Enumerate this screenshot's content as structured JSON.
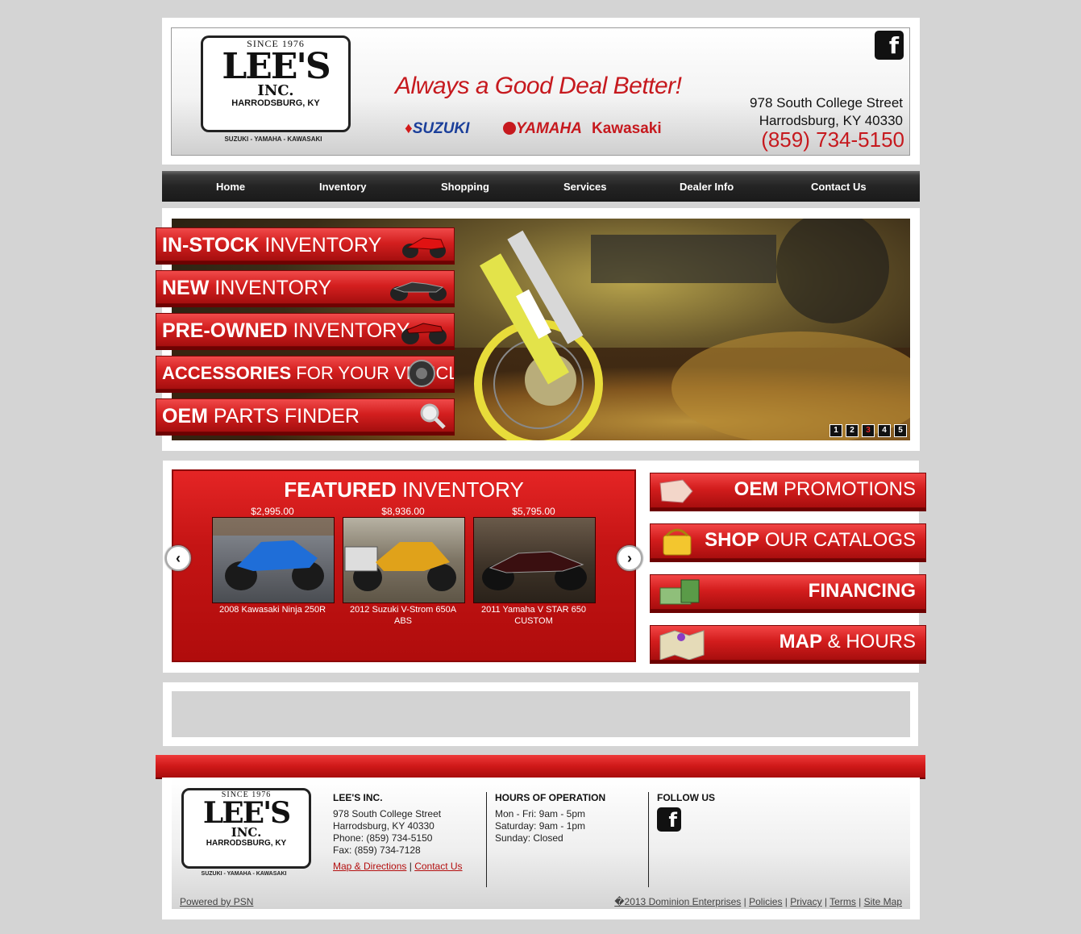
{
  "header": {
    "logo": {
      "since": "SINCE 1976",
      "name": "LEE'S",
      "inc": "INC.",
      "city": "HARRODSBURG, KY",
      "brands_line": "SUZUKI - YAMAHA - KAWASAKI"
    },
    "tagline": "Always a Good Deal Better!",
    "brands": [
      "SUZUKI",
      "YAMAHA",
      "Kawasaki"
    ],
    "address_line1": "978 South College Street",
    "address_line2": "Harrodsburg, KY 40330",
    "phone": "(859) 734-5150",
    "facebook_icon": "f"
  },
  "nav": [
    "Home",
    "Inventory",
    "Shopping",
    "Services",
    "Dealer Info",
    "Contact Us"
  ],
  "hero_tabs": [
    {
      "bold": "IN-STOCK",
      "rest": " INVENTORY",
      "icon": "sport-bike-icon"
    },
    {
      "bold": "NEW",
      "rest": " INVENTORY",
      "icon": "cruiser-icon"
    },
    {
      "bold": "PRE-OWNED",
      "rest": " INVENTORY",
      "icon": "atv-icon"
    },
    {
      "bold": "ACCESSORIES",
      "rest": " FOR YOUR VEHICLE",
      "icon": "tire-icon"
    },
    {
      "bold": "OEM",
      "rest": " PARTS FINDER",
      "icon": "magnifier-icon"
    }
  ],
  "slides": {
    "labels": [
      "1",
      "2",
      "3",
      "4",
      "5"
    ],
    "active": "3"
  },
  "featured": {
    "title_bold": "FEATURED",
    "title_rest": " INVENTORY",
    "items": [
      {
        "price": "$2,995.00",
        "name": "2008 Kawasaki Ninja 250R"
      },
      {
        "price": "$8,936.00",
        "name": "2012 Suzuki V-Strom 650A ABS"
      },
      {
        "price": "$5,795.00",
        "name": "2011 Yamaha V STAR 650 CUSTOM"
      }
    ],
    "prev_arrow": "‹",
    "next_arrow": "›"
  },
  "side_buttons": [
    {
      "bold": "OEM",
      "rest": " PROMOTIONS",
      "icon": "sale-tag-icon"
    },
    {
      "bold": "SHOP",
      "rest": " OUR CATALOGS",
      "icon": "basket-icon"
    },
    {
      "bold": "FINANCING",
      "rest": "",
      "icon": "money-icon"
    },
    {
      "bold": "MAP",
      "rest": " & HOURS",
      "icon": "map-icon"
    }
  ],
  "footer": {
    "company": {
      "title": "LEE'S INC.",
      "lines": [
        "978 South College Street",
        "Harrodsburg, KY 40330",
        "Phone: (859) 734-5150",
        "Fax: (859) 734-7128"
      ],
      "link1": "Map & Directions",
      "separator": "|",
      "link2": "Contact Us"
    },
    "hours": {
      "title": "HOURS OF OPERATION",
      "lines": [
        "Mon - Fri: 9am - 5pm",
        "Saturday: 9am - 1pm",
        "Sunday: Closed"
      ]
    },
    "follow": {
      "title": "FOLLOW US"
    },
    "powered": "Powered by PSN",
    "copyright": "�2013 Dominion Enterprises",
    "links": [
      "Policies",
      "Privacy",
      "Terms",
      "Site Map"
    ]
  }
}
